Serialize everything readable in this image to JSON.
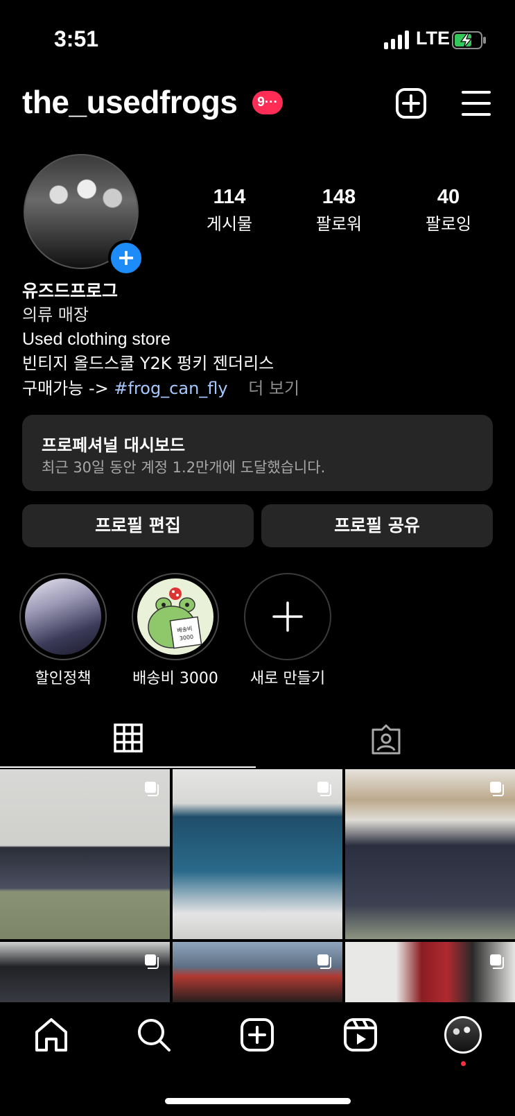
{
  "status_bar": {
    "time": "3:51",
    "network": "LTE"
  },
  "header": {
    "username": "the_usedfrogs",
    "notification_badge": "9···"
  },
  "profile": {
    "stats": [
      {
        "count": "114",
        "label": "게시물"
      },
      {
        "count": "148",
        "label": "팔로워"
      },
      {
        "count": "40",
        "label": "팔로잉"
      }
    ],
    "name": "유즈드프로그",
    "category": "의류 매장",
    "bio_line1": "Used clothing store",
    "bio_line2": "빈티지 올드스쿨 Y2K 펑키 젠더리스",
    "bio_line3_prefix": "구매가능 ->",
    "bio_line3_hashtag": "#frog_can_fly",
    "more": "더 보기"
  },
  "dashboard": {
    "title": "프로페셔널 대시보드",
    "subtitle": "최근 30일 동안 계정 1.2만개에 도달했습니다."
  },
  "buttons": {
    "edit": "프로필 편집",
    "share": "프로필 공유"
  },
  "highlights": [
    {
      "label": "할인정책"
    },
    {
      "label": "배송비 3000",
      "sign_text_1": "배송비",
      "sign_text_2": "3000"
    },
    {
      "label": "새로 만들기"
    }
  ],
  "colors": {
    "accent_blue": "#1d8cf8",
    "badge_red": "#ff2d55",
    "hashtag": "#a6c8ff",
    "card_bg": "#262626"
  }
}
